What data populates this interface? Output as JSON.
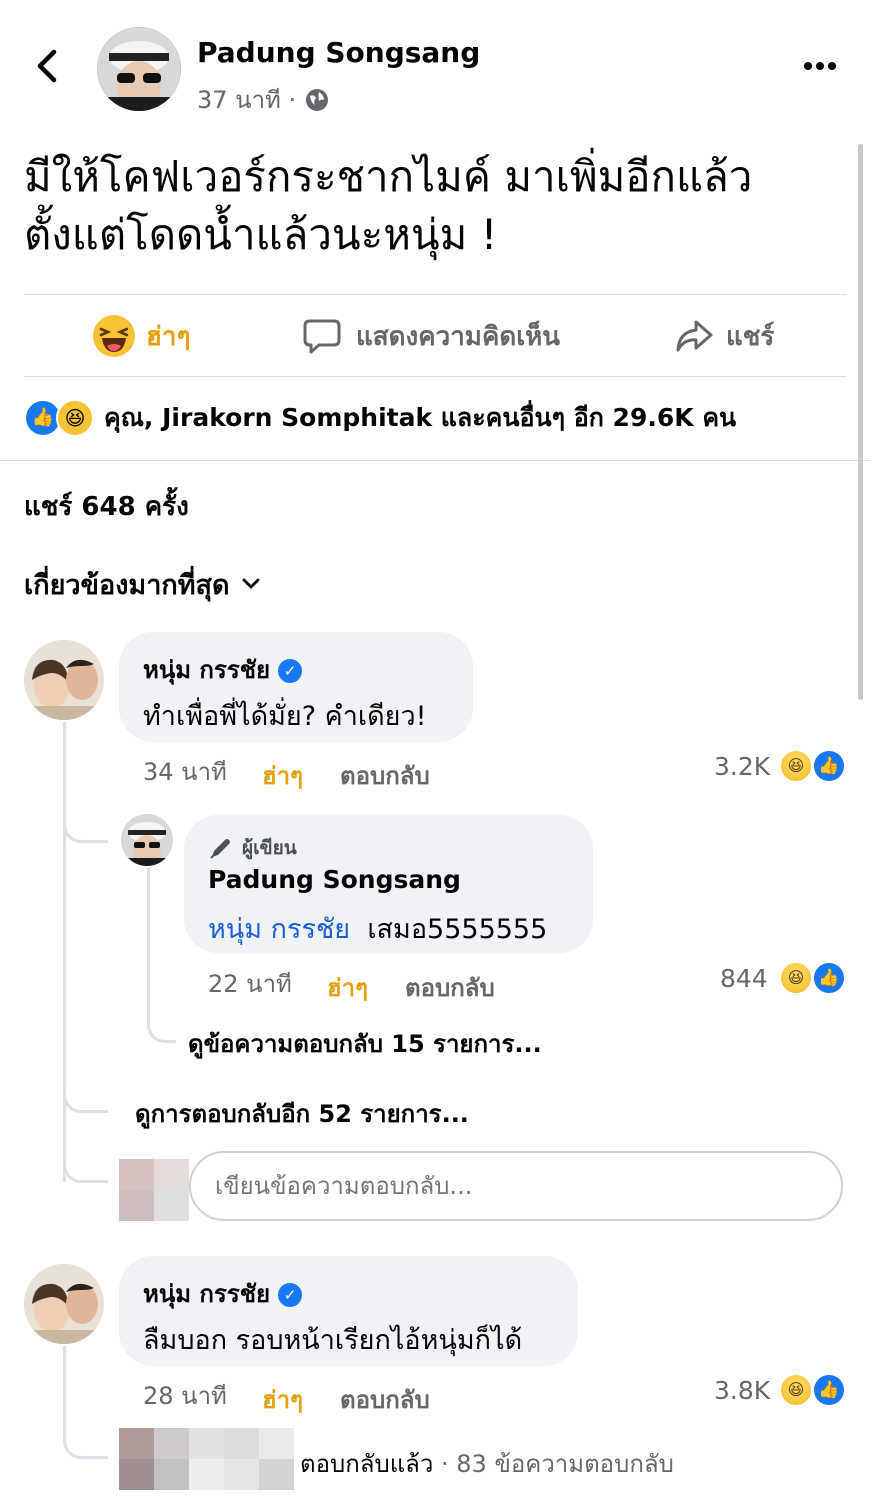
{
  "header": {
    "author": "Padung Songsang",
    "time": "37 นาที",
    "dot": "·",
    "back_icon": "chevron-left-icon",
    "more_icon": "more-dots-icon",
    "privacy_icon": "globe-icon"
  },
  "post": {
    "line1": "มีให้โคฟเวอร์กระชากไมค์ มาเพิ่มอีกแล้ว",
    "line2": "ตั้งแต่โดดน้ำแล้วนะหนุ่ม  !"
  },
  "actions": {
    "haha_label": "ฮ่าๆ",
    "comment_label": "แสดงความคิดเห็น",
    "share_label": "แชร์"
  },
  "reactions_summary": "คุณ, Jirakorn Somphitak และคนอื่นๆ อีก 29.6K คน",
  "share_count": "แชร์ 648 ครั้ง",
  "sort_label": "เกี่ยวข้องมากที่สุด",
  "comments": [
    {
      "name": "หนุ่ม กรรชัย",
      "text": "ทำเพื่อพี่ได้มั่ย? คำเดียว!",
      "time": "34 นาที",
      "haha": "ฮ่าๆ",
      "reply": "ตอบกลับ",
      "count": "3.2K"
    },
    {
      "name": "หนุ่ม กรรชัย",
      "text": "ลืมบอก รอบหน้าเรียกไอ้หนุ่มก็ได้",
      "time": "28 นาที",
      "haha": "ฮ่าๆ",
      "reply": "ตอบกลับ",
      "count": "3.8K"
    }
  ],
  "author_reply": {
    "badge": "ผู้เขียน",
    "name": "Padung Songsang",
    "mention": "หนุ่ม กรรชัย",
    "text": "เสมอ5555555",
    "time": "22 นาที",
    "haha": "ฮ่าๆ",
    "reply": "ตอบกลับ",
    "count": "844"
  },
  "view_replies_nested": "ดูข้อความตอบกลับ 15 รายการ...",
  "view_more_replies": "ดูการตอบกลับอีก 52 รายการ...",
  "reply_input_placeholder": "เขียนข้อความตอบกลับ...",
  "replied_summary": {
    "label": "ตอบกลับแล้ว",
    "dot": "·",
    "count": "83 ข้อความตอบกลับ"
  },
  "colors": {
    "accent": "#1877f2",
    "haha": "#e5a00d",
    "secondary_text": "#65676b",
    "bubble": "#f0f2f5"
  }
}
